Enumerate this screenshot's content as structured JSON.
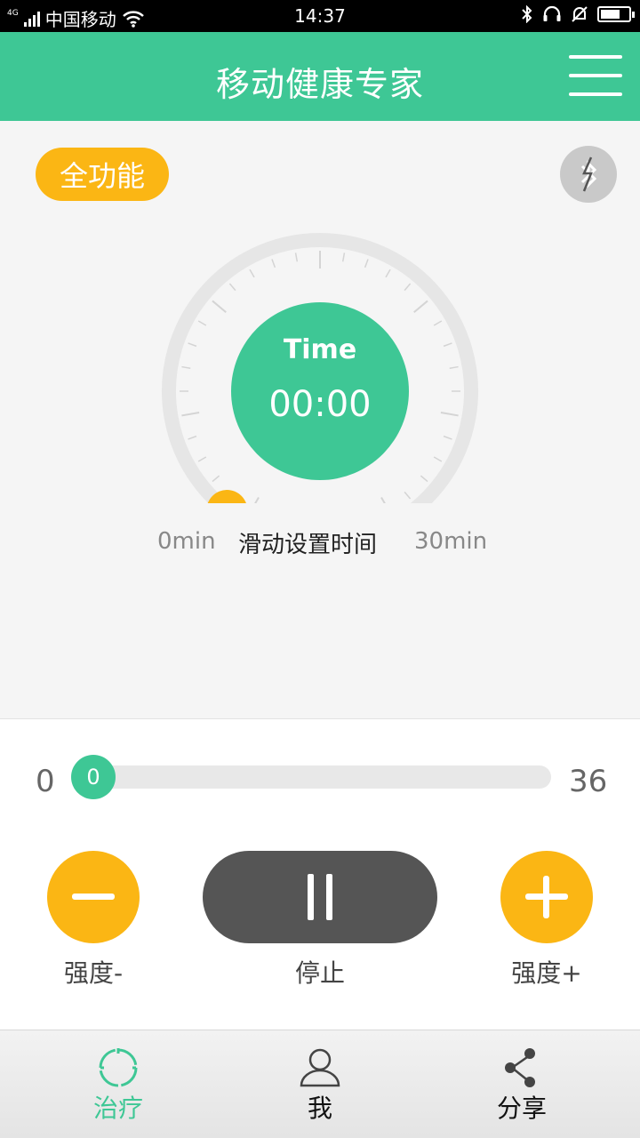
{
  "status_bar": {
    "network": "4G",
    "carrier": "中国移动",
    "time": "14:37",
    "icons": [
      "signal-icon",
      "wifi-icon",
      "bluetooth-icon",
      "headset-icon",
      "bell-muted-icon",
      "battery-icon"
    ]
  },
  "header": {
    "title": "移动健康专家",
    "menu_icon": "hamburger-menu-icon"
  },
  "main": {
    "mode_badge": "全功能",
    "bluetooth_icon": "bluetooth-disconnected-icon",
    "timer": {
      "label": "Time",
      "value": "00:00",
      "range_min": "0min",
      "range_hint": "滑动设置时间",
      "range_max": "30min"
    }
  },
  "intensity": {
    "min": "0",
    "max": "36",
    "current": "0",
    "level": 0
  },
  "controls": {
    "minus_label": "强度-",
    "stop_label": "停止",
    "plus_label": "强度+"
  },
  "nav": {
    "items": [
      {
        "label": "治疗",
        "icon": "treatment-icon",
        "active": true
      },
      {
        "label": "我",
        "icon": "user-icon",
        "active": false
      },
      {
        "label": "分享",
        "icon": "share-icon",
        "active": false
      }
    ]
  },
  "colors": {
    "primary": "#3ec795",
    "accent": "#fbb614",
    "dark": "#555555"
  }
}
